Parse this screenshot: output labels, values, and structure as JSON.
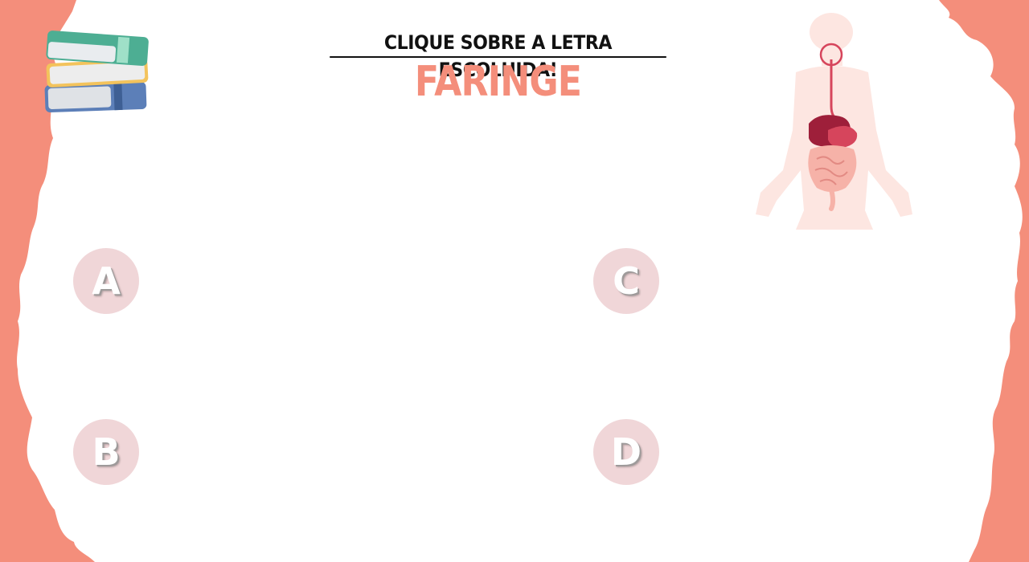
{
  "instruction": "CLIQUE SOBRE A LETRA ESCOLHIDA!",
  "topic": "FARINGE",
  "options": [
    {
      "letter": "A"
    },
    {
      "letter": "B"
    },
    {
      "letter": "C"
    },
    {
      "letter": "D"
    }
  ],
  "colors": {
    "accent": "#f48e7b",
    "option_bg": "#f0d6d8",
    "heading": "#111111"
  },
  "icons": [
    "books-icon",
    "digestive-system-icon"
  ]
}
